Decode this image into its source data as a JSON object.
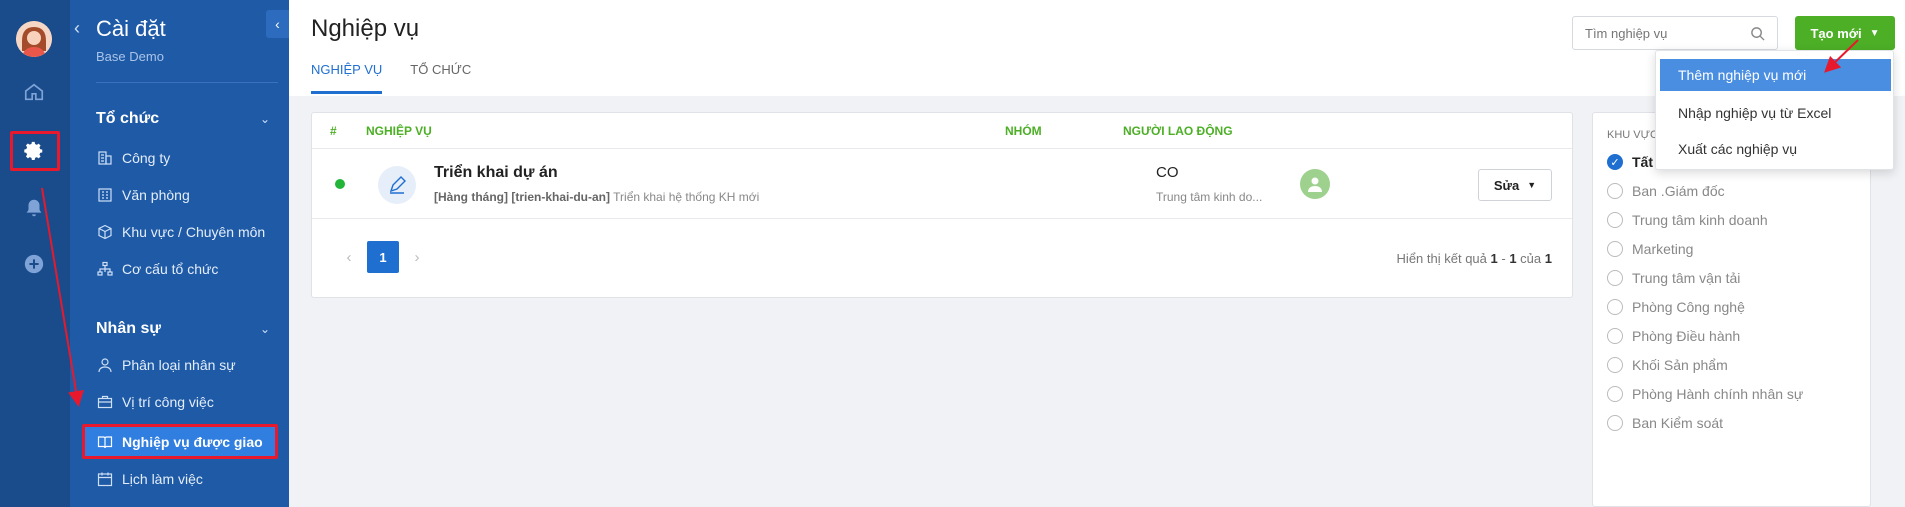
{
  "rail": {
    "icons": [
      "avatar",
      "home-icon",
      "gear-icon",
      "bell-icon",
      "plus-circle-icon"
    ]
  },
  "sidebar": {
    "title": "Cài đặt",
    "subtitle": "Base Demo",
    "sections": [
      {
        "label": "Tổ chức",
        "items": [
          {
            "label": "Công ty",
            "icon": "building-icon"
          },
          {
            "label": "Văn phòng",
            "icon": "office-icon"
          },
          {
            "label": "Khu vực / Chuyên môn",
            "icon": "cube-icon"
          },
          {
            "label": "Cơ cấu tổ chức",
            "icon": "org-chart-icon"
          }
        ]
      },
      {
        "label": "Nhân sự",
        "items": [
          {
            "label": "Phân loại nhân sự",
            "icon": "user-icon"
          },
          {
            "label": "Vị trí công việc",
            "icon": "briefcase-icon"
          },
          {
            "label": "Nghiệp vụ được giao",
            "icon": "book-icon",
            "active": true
          },
          {
            "label": "Lịch làm việc",
            "icon": "calendar-icon"
          }
        ]
      }
    ]
  },
  "header": {
    "title": "Nghiệp vụ",
    "tabs": [
      {
        "label": "NGHIỆP VỤ",
        "active": true
      },
      {
        "label": "TỔ CHỨC",
        "active": false
      }
    ],
    "search_placeholder": "Tìm nghiệp vụ",
    "create_label": "Tạo mới"
  },
  "dropdown": {
    "items": [
      "Thêm nghiệp vụ mới",
      "Nhập nghiệp vụ từ Excel",
      "Xuất các nghiệp vụ"
    ]
  },
  "table": {
    "columns": [
      "#",
      "NGHIỆP VỤ",
      "NHÓM",
      "NGƯỜI LAO ĐỘNG"
    ],
    "rows": [
      {
        "name": "Triển khai dự án",
        "tag1": "[Hàng tháng]",
        "tag2": "[trien-khai-du-an]",
        "desc": "Triển khai hệ thống KH mới",
        "group": "CO",
        "group_sub": "Trung tâm kinh do...",
        "edit_label": "Sửa"
      }
    ],
    "pagination": {
      "current": "1"
    },
    "result": {
      "prefix": "Hiển thị kết quả",
      "from": "1",
      "to": "1",
      "of_label": "của",
      "total": "1"
    }
  },
  "filter": {
    "title": "Khu vực",
    "options": [
      {
        "label": "Tất cả",
        "checked": true
      },
      {
        "label": "Ban .Giám đốc"
      },
      {
        "label": "Trung tâm kinh doanh"
      },
      {
        "label": "Marketing"
      },
      {
        "label": "Trung tâm vận tải"
      },
      {
        "label": "Phòng Công nghệ"
      },
      {
        "label": "Phòng Điều hành"
      },
      {
        "label": "Khối Sản phẩm"
      },
      {
        "label": "Phòng Hành chính nhân sự"
      },
      {
        "label": "Ban Kiểm soát"
      }
    ]
  },
  "colors": {
    "rail": "#1a4c8c",
    "sidebar": "#1f5aa6",
    "accent": "#1f6fd1",
    "green": "#4caf26",
    "annotation": "#e8192c"
  }
}
